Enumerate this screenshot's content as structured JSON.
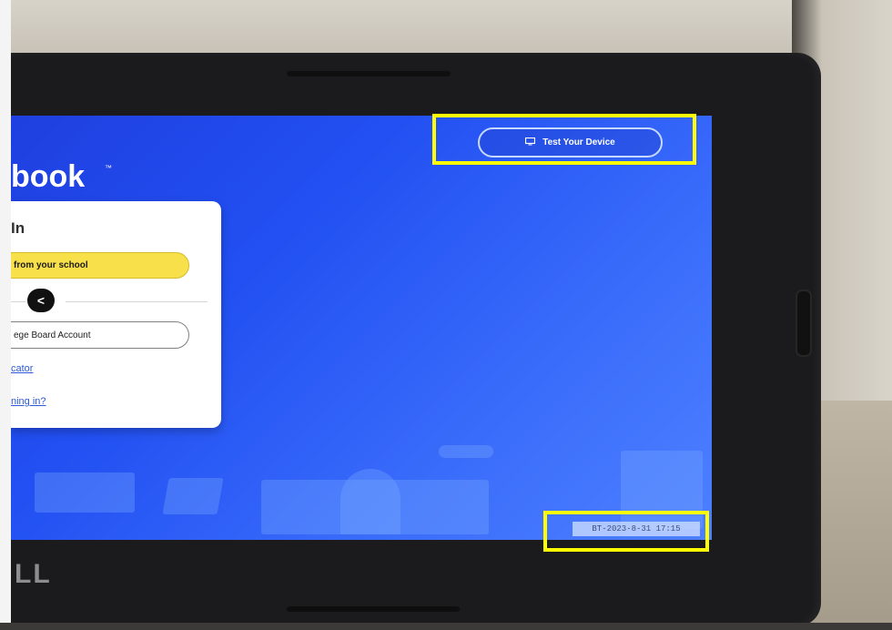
{
  "screen": {
    "logo_text": "book",
    "logo_tm": "™",
    "test_device_button": {
      "icon": "monitor-icon",
      "label": "Test Your Device"
    },
    "signin_card": {
      "title": "In",
      "school_button_label": "from your school",
      "back_button_label": "<",
      "college_board_button_label": "ege Board Account",
      "link_educator": "cator",
      "link_help": "ning in?"
    },
    "version_label": "BT-2023-8-31 17:15"
  },
  "laptop": {
    "brand_text": "LL"
  },
  "colors": {
    "highlight": "#ffff00",
    "screen_blue": "#2250f2",
    "school_button_yellow": "#f8e04a",
    "link_blue": "#2d5bd6"
  }
}
